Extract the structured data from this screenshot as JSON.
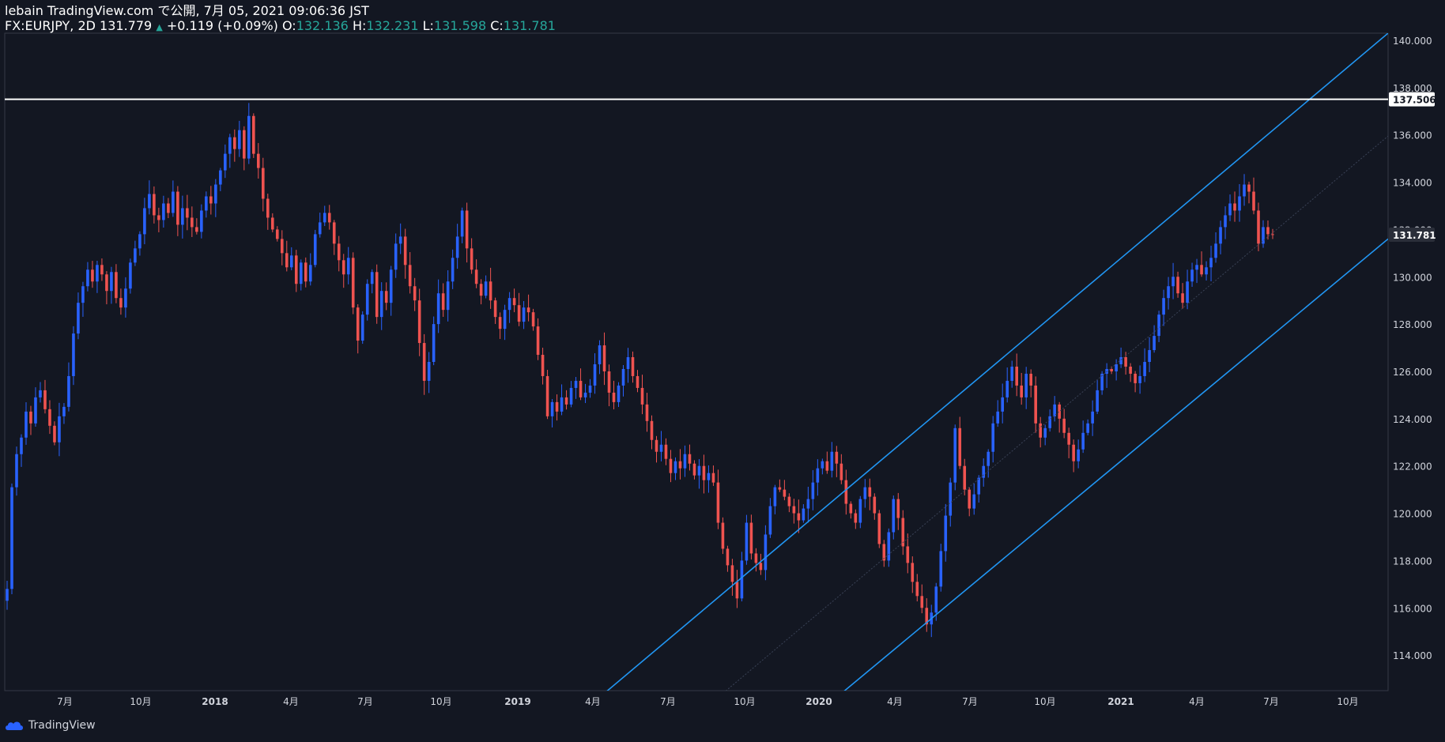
{
  "header": {
    "published_line": "lebain TradingView.com で公開, 7月 05, 2021 09:06:36 JST",
    "symbol": "FX:EURJPY, 2D",
    "last": "131.779",
    "change_arrow": "▲",
    "change": "+0.119 (+0.09%)",
    "open_label": "O:",
    "open": "132.136",
    "high_label": "H:",
    "high": "132.231",
    "low_label": "L:",
    "low": "131.598",
    "close_label": "C:",
    "close": "131.781"
  },
  "footer": {
    "brand": "TradingView"
  },
  "colors": {
    "background": "#131722",
    "up": "#2962ff",
    "down": "#ef5350",
    "channel": "#2196f3",
    "horizontal_line": "#ffffff",
    "axis_text": "#d1d4dc"
  },
  "chart_data": {
    "type": "candlestick",
    "symbol": "FX:EURJPY",
    "interval": "2D",
    "ylim": [
      112.5,
      140.3
    ],
    "y_ticks": [
      "114.000",
      "116.000",
      "118.000",
      "120.000",
      "122.000",
      "124.000",
      "126.000",
      "128.000",
      "130.000",
      "132.000",
      "134.000",
      "136.000",
      "138.000",
      "140.000"
    ],
    "x_ticks": [
      "7月",
      "10月",
      "2018",
      "4月",
      "7月",
      "10月",
      "2019",
      "4月",
      "7月",
      "10月",
      "2020",
      "4月",
      "7月",
      "10月",
      "2021",
      "4月",
      "7月",
      "10月"
    ],
    "price_labels": [
      {
        "value": 137.506,
        "text": "137.506",
        "style": "horizontal-line"
      },
      {
        "value": 131.781,
        "text": "131.781",
        "style": "last-price"
      }
    ],
    "horizontal_line": {
      "value": 137.506
    },
    "closes": [
      116.8,
      121.1,
      122.5,
      123.2,
      124.3,
      123.8,
      124.9,
      125.2,
      124.4,
      123.7,
      123.0,
      124.1,
      124.5,
      125.8,
      127.6,
      128.9,
      129.6,
      130.3,
      129.8,
      130.5,
      130.1,
      129.4,
      130.2,
      129.1,
      128.7,
      129.5,
      130.6,
      131.2,
      131.8,
      132.9,
      133.5,
      132.6,
      132.4,
      133.1,
      132.7,
      133.6,
      132.2,
      132.9,
      132.5,
      132.1,
      131.9,
      132.8,
      133.4,
      133.1,
      133.9,
      134.5,
      135.2,
      135.9,
      135.4,
      136.2,
      135.0,
      136.8,
      135.2,
      134.6,
      133.3,
      132.5,
      132.0,
      131.6,
      131.0,
      130.4,
      130.9,
      129.7,
      130.6,
      129.8,
      130.5,
      131.8,
      132.3,
      132.7,
      132.3,
      131.4,
      130.7,
      130.1,
      130.8,
      128.7,
      127.3,
      128.4,
      129.7,
      130.2,
      128.3,
      129.4,
      128.9,
      130.3,
      131.4,
      131.7,
      130.5,
      129.6,
      129.0,
      127.2,
      125.6,
      126.4,
      128.0,
      129.3,
      128.6,
      129.8,
      130.8,
      131.7,
      132.8,
      131.2,
      130.3,
      129.7,
      129.2,
      129.8,
      129.0,
      128.3,
      127.8,
      128.6,
      129.1,
      128.8,
      128.1,
      128.7,
      128.5,
      127.9,
      126.7,
      125.8,
      124.1,
      124.7,
      124.3,
      124.9,
      124.6,
      125.3,
      125.6,
      124.9,
      125.1,
      125.4,
      126.3,
      127.1,
      126.0,
      125.1,
      124.7,
      125.4,
      126.1,
      126.6,
      125.8,
      125.3,
      124.6,
      123.9,
      123.1,
      122.6,
      122.9,
      122.3,
      121.7,
      122.2,
      121.9,
      122.5,
      122.1,
      121.6,
      122.0,
      121.4,
      121.7,
      121.3,
      119.6,
      118.5,
      117.8,
      117.1,
      116.4,
      118.0,
      119.6,
      118.3,
      117.9,
      117.6,
      119.1,
      120.3,
      121.1,
      121.0,
      120.7,
      120.3,
      120.0,
      119.7,
      120.2,
      120.6,
      121.3,
      121.9,
      122.2,
      121.8,
      122.6,
      122.1,
      121.4,
      120.4,
      120.0,
      119.6,
      120.6,
      121.1,
      120.7,
      120.0,
      118.7,
      118.0,
      119.2,
      120.6,
      119.8,
      118.6,
      117.9,
      117.1,
      116.5,
      116.0,
      115.3,
      115.8,
      116.9,
      118.4,
      119.9,
      121.3,
      123.6,
      122.0,
      121.0,
      120.2,
      120.8,
      121.5,
      122.0,
      122.6,
      123.8,
      124.3,
      124.9,
      125.6,
      126.2,
      125.4,
      124.9,
      125.9,
      125.4,
      123.8,
      123.2,
      123.6,
      124.1,
      124.6,
      124.0,
      123.4,
      122.9,
      122.2,
      122.7,
      123.4,
      123.8,
      124.3,
      125.2,
      125.9,
      126.1,
      126.0,
      126.3,
      126.6,
      126.2,
      125.9,
      125.5,
      125.8,
      126.4,
      126.9,
      127.5,
      128.4,
      129.1,
      129.6,
      130.0,
      129.3,
      128.9,
      129.8,
      130.3,
      130.5,
      130.1,
      130.4,
      130.8,
      131.4,
      132.1,
      132.6,
      133.1,
      132.8,
      133.4,
      133.9,
      133.6,
      132.8,
      131.4,
      132.1,
      131.8,
      131.781
    ],
    "trend_channel": {
      "upper": [
        {
          "date": "2019-04",
          "value": 112.4
        },
        {
          "date": "2021-11",
          "value": 140.3
        }
      ],
      "lower": [
        {
          "date": "2020-01",
          "value": 112.4
        },
        {
          "date": "2021-11",
          "value": 131.6
        }
      ]
    }
  }
}
